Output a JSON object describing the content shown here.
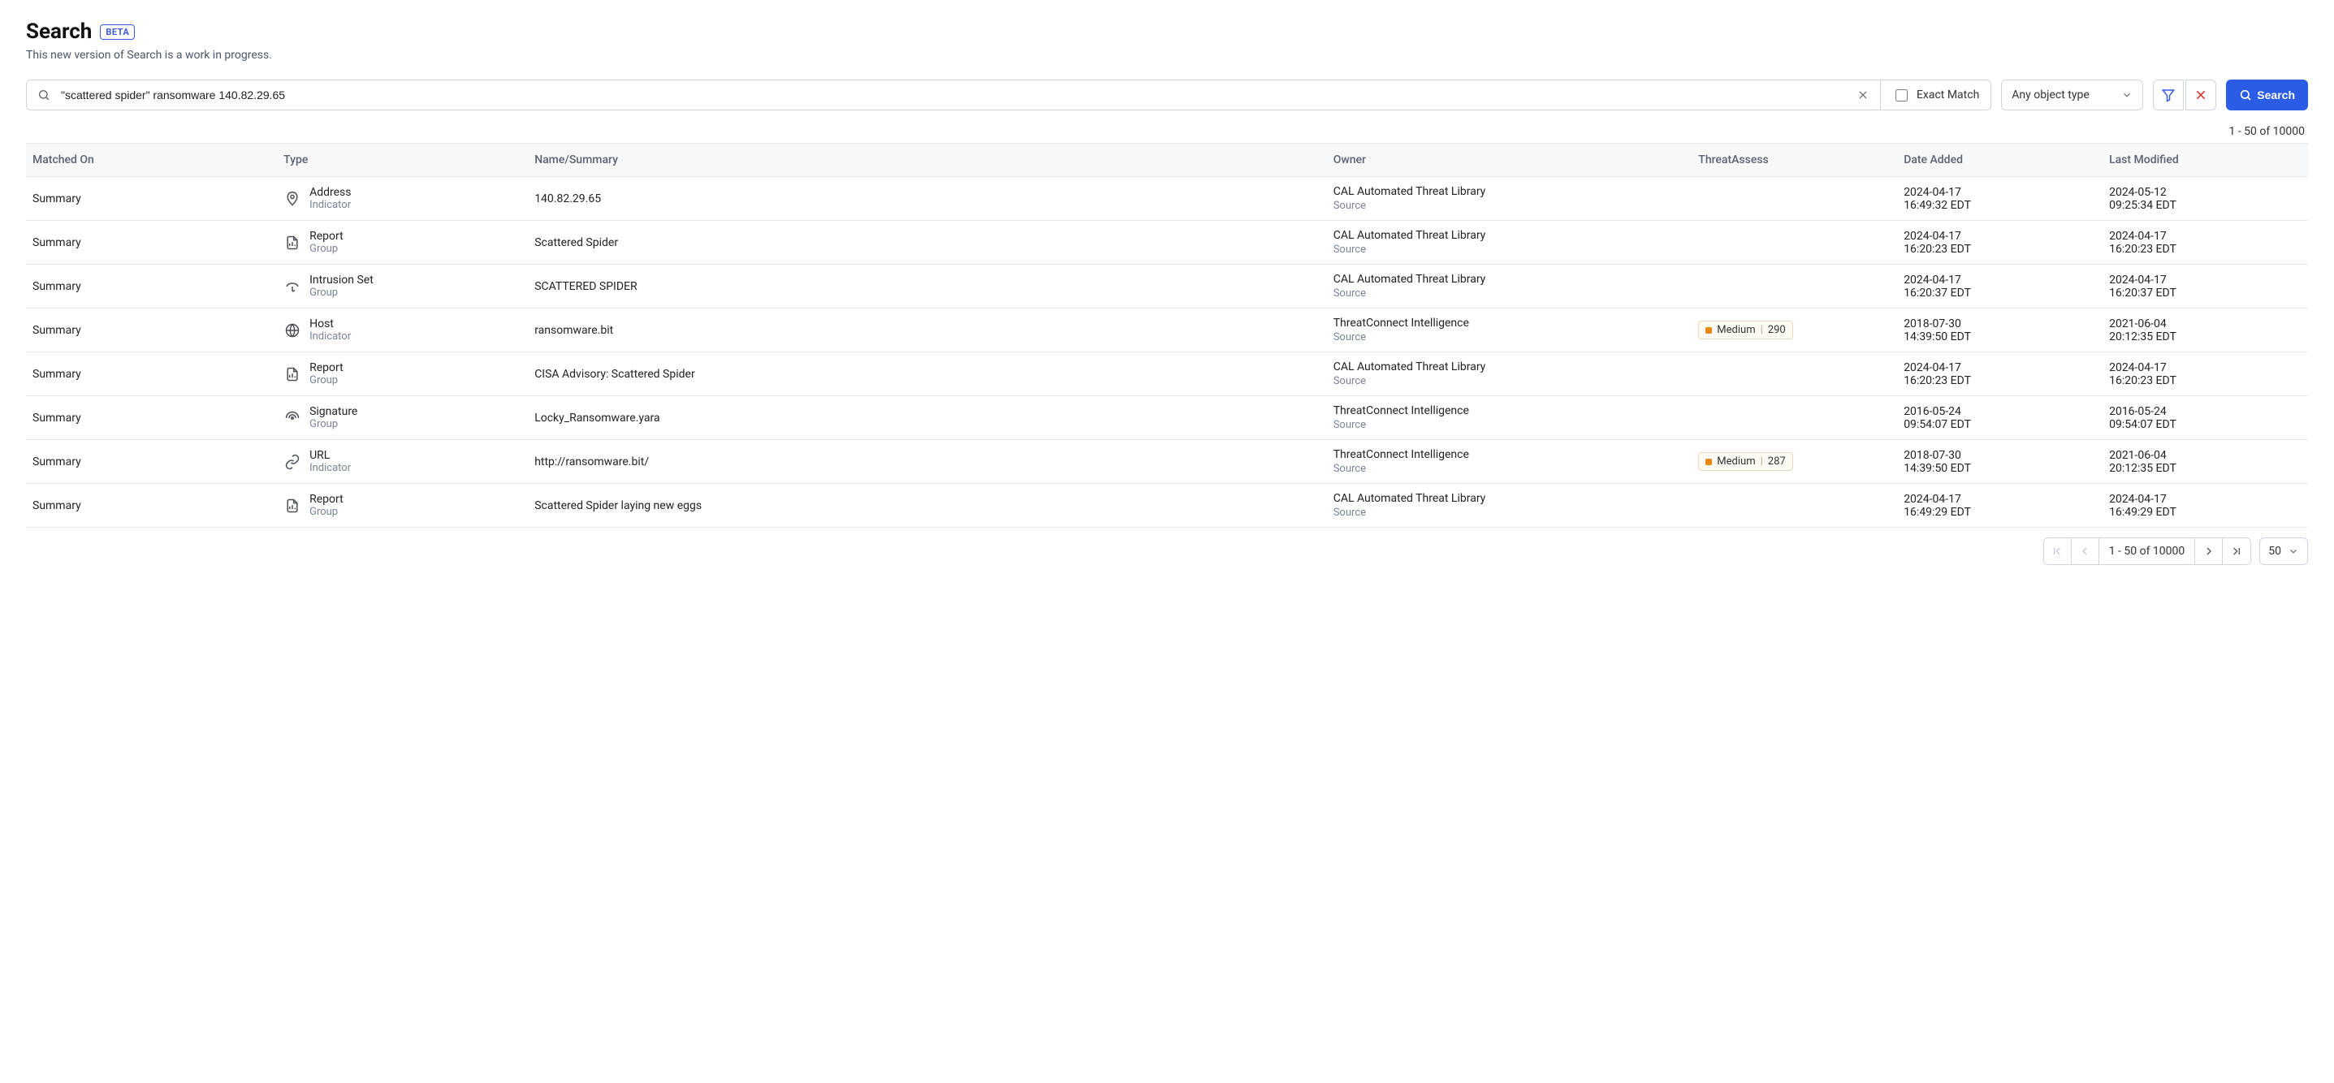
{
  "header": {
    "title": "Search",
    "badge": "BETA",
    "subtitle": "This new version of Search is a work in progress."
  },
  "controls": {
    "query": "\"scattered spider\" ransomware 140.82.29.65",
    "exact_match_label": "Exact Match",
    "object_type": "Any object type",
    "search_label": "Search"
  },
  "count": "1 - 50 of 10000",
  "columns": {
    "matched": "Matched On",
    "type": "Type",
    "name": "Name/Summary",
    "owner": "Owner",
    "threat": "ThreatAssess",
    "added": "Date Added",
    "modified": "Last Modified"
  },
  "rows": [
    {
      "matched": "Summary",
      "icon": "address",
      "type": "Address",
      "subtype": "Indicator",
      "name": "140.82.29.65",
      "owner": "CAL Automated Threat Library",
      "owner_sub": "Source",
      "threat": null,
      "added_date": "2024-04-17",
      "added_time": "16:49:32 EDT",
      "mod_date": "2024-05-12",
      "mod_time": "09:25:34 EDT"
    },
    {
      "matched": "Summary",
      "icon": "report",
      "type": "Report",
      "subtype": "Group",
      "name": "Scattered Spider",
      "owner": "CAL Automated Threat Library",
      "owner_sub": "Source",
      "threat": null,
      "added_date": "2024-04-17",
      "added_time": "16:20:23 EDT",
      "mod_date": "2024-04-17",
      "mod_time": "16:20:23 EDT"
    },
    {
      "matched": "Summary",
      "icon": "intrusion",
      "type": "Intrusion Set",
      "subtype": "Group",
      "name": "SCATTERED SPIDER",
      "owner": "CAL Automated Threat Library",
      "owner_sub": "Source",
      "threat": null,
      "added_date": "2024-04-17",
      "added_time": "16:20:37 EDT",
      "mod_date": "2024-04-17",
      "mod_time": "16:20:37 EDT"
    },
    {
      "matched": "Summary",
      "icon": "host",
      "type": "Host",
      "subtype": "Indicator",
      "name": "ransomware.bit",
      "owner": "ThreatConnect Intelligence",
      "owner_sub": "Source",
      "threat": {
        "label": "Medium",
        "score": "290"
      },
      "added_date": "2018-07-30",
      "added_time": "14:39:50 EDT",
      "mod_date": "2021-06-04",
      "mod_time": "20:12:35 EDT"
    },
    {
      "matched": "Summary",
      "icon": "report",
      "type": "Report",
      "subtype": "Group",
      "name": "CISA Advisory: Scattered Spider",
      "owner": "CAL Automated Threat Library",
      "owner_sub": "Source",
      "threat": null,
      "added_date": "2024-04-17",
      "added_time": "16:20:23 EDT",
      "mod_date": "2024-04-17",
      "mod_time": "16:20:23 EDT"
    },
    {
      "matched": "Summary",
      "icon": "signature",
      "type": "Signature",
      "subtype": "Group",
      "name": "Locky_Ransomware.yara",
      "owner": "ThreatConnect Intelligence",
      "owner_sub": "Source",
      "threat": null,
      "added_date": "2016-05-24",
      "added_time": "09:54:07 EDT",
      "mod_date": "2016-05-24",
      "mod_time": "09:54:07 EDT"
    },
    {
      "matched": "Summary",
      "icon": "url",
      "type": "URL",
      "subtype": "Indicator",
      "name": "http://ransomware.bit/",
      "owner": "ThreatConnect Intelligence",
      "owner_sub": "Source",
      "threat": {
        "label": "Medium",
        "score": "287"
      },
      "added_date": "2018-07-30",
      "added_time": "14:39:50 EDT",
      "mod_date": "2021-06-04",
      "mod_time": "20:12:35 EDT"
    },
    {
      "matched": "Summary",
      "icon": "report",
      "type": "Report",
      "subtype": "Group",
      "name": "Scattered Spider laying new eggs",
      "owner": "CAL Automated Threat Library",
      "owner_sub": "Source",
      "threat": null,
      "added_date": "2024-04-17",
      "added_time": "16:49:29 EDT",
      "mod_date": "2024-04-17",
      "mod_time": "16:49:29 EDT"
    }
  ],
  "pager": {
    "text": "1 - 50 of 10000",
    "page_size": "50"
  }
}
